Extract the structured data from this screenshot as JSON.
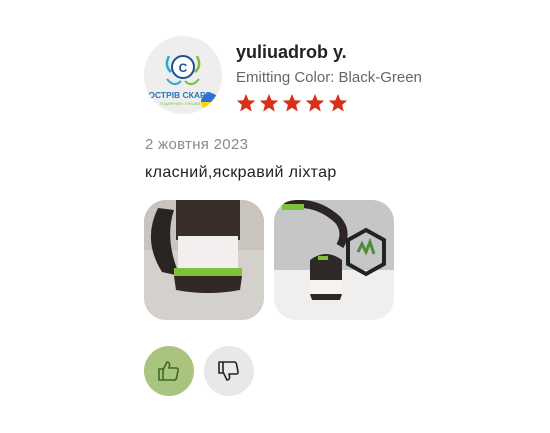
{
  "review": {
    "author": "yuliuadrob y.",
    "variant": "Emitting Color: Black-Green",
    "rating": 5,
    "rating_max": 5,
    "date": "2 жовтня 2023",
    "text": "класний,яскравий ліхтар"
  },
  "avatar": {
    "logo_text": "ОСТРІВ СКАРБ",
    "logo_subtext": "ПОДАРУНКИ • ІГРАШКИ",
    "icon": "octopus-logo",
    "badge_icon": "ukraine-flag-icon"
  },
  "photos": [
    {
      "icon": "lantern-photo-closeup"
    },
    {
      "icon": "lantern-photo-table"
    }
  ],
  "actions": {
    "like_icon": "thumbs-up-icon",
    "dislike_icon": "thumbs-down-icon"
  },
  "colors": {
    "star": "#d9301c",
    "like_bg": "#a8c47f",
    "dislike_bg": "#e8e8e8",
    "username": "#222222",
    "muted": "#666666"
  }
}
